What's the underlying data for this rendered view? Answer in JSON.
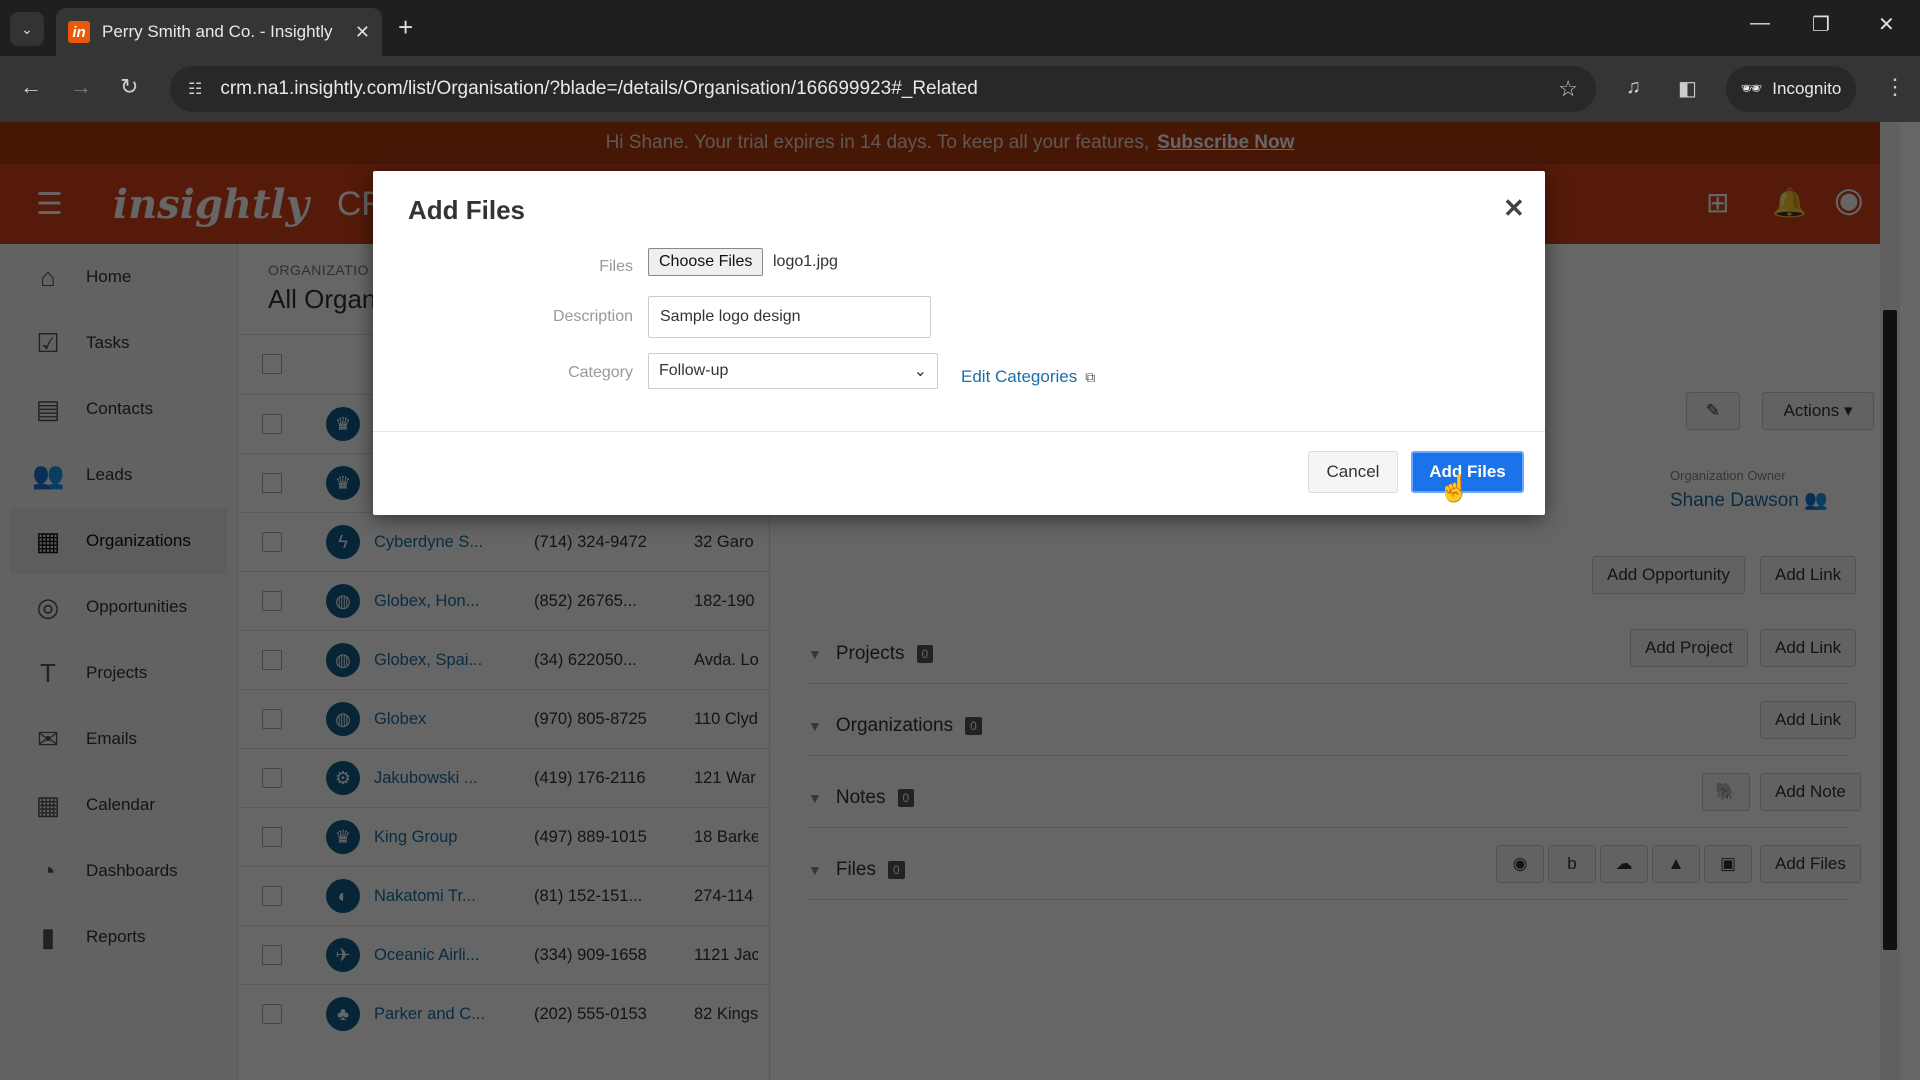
{
  "browser": {
    "tab_title": "Perry Smith and Co. - Insightly",
    "tab_favicon": "in",
    "url": "crm.na1.insightly.com/list/Organisation/?blade=/details/Organisation/166699923#_Related",
    "incognito_label": "Incognito"
  },
  "banner": {
    "text": "Hi Shane. Your trial expires in 14 days. To keep all your features,",
    "link": "Subscribe Now"
  },
  "appbar": {
    "logo": "insightly",
    "product": "CRM"
  },
  "sidebar": {
    "items": [
      {
        "label": "Home",
        "icon": "home-icon"
      },
      {
        "label": "Tasks",
        "icon": "tasks-icon"
      },
      {
        "label": "Contacts",
        "icon": "contacts-icon"
      },
      {
        "label": "Leads",
        "icon": "leads-icon"
      },
      {
        "label": "Organizations",
        "icon": "organizations-icon",
        "active": true
      },
      {
        "label": "Opportunities",
        "icon": "opportunities-icon"
      },
      {
        "label": "Projects",
        "icon": "projects-icon"
      },
      {
        "label": "Emails",
        "icon": "emails-icon"
      },
      {
        "label": "Calendar",
        "icon": "calendar-icon"
      },
      {
        "label": "Dashboards",
        "icon": "dashboards-icon"
      },
      {
        "label": "Reports",
        "icon": "reports-icon"
      }
    ]
  },
  "list": {
    "section_label": "ORGANIZATIO",
    "title": "All Organ",
    "rows": [
      {
        "name": "",
        "phone": "",
        "address": ""
      },
      {
        "name": "",
        "phone": "",
        "address": ""
      },
      {
        "name": "Cyberdyne S...",
        "phone": "(714) 324-9472",
        "address": "32 Garo"
      },
      {
        "name": "Globex, Hon...",
        "phone": "(852) 26765...",
        "address": "182-190"
      },
      {
        "name": "Globex, Spai...",
        "phone": "(34) 622050...",
        "address": "Avda. Lo"
      },
      {
        "name": "Globex",
        "phone": "(970) 805-8725",
        "address": "110 Clyd"
      },
      {
        "name": "Jakubowski ...",
        "phone": "(419) 176-2116",
        "address": "121 War"
      },
      {
        "name": "King Group",
        "phone": "(497) 889-1015",
        "address": "18 Barke"
      },
      {
        "name": "Nakatomi Tr...",
        "phone": "(81) 152-151...",
        "address": "274-114"
      },
      {
        "name": "Oceanic Airli...",
        "phone": "(334) 909-1658",
        "address": "1121 Jac"
      },
      {
        "name": "Parker and C...",
        "phone": "(202) 555-0153",
        "address": "82 Kings"
      }
    ]
  },
  "detail": {
    "actions_label": "Actions",
    "owner_label": "Organization Owner",
    "owner_name": "Shane Dawson",
    "sections": [
      {
        "title": "Projects",
        "count": "0",
        "buttons": [
          "Add Project",
          "Add Link"
        ]
      },
      {
        "title": "Organizations",
        "count": "0",
        "buttons": [
          "Add Link"
        ]
      },
      {
        "title": "Notes",
        "count": "0",
        "buttons": [
          "Add Note"
        ]
      },
      {
        "title": "Files",
        "count": "0",
        "buttons": [
          "Add Files"
        ]
      }
    ],
    "opportunity_buttons": [
      "Add Opportunity",
      "Add Link"
    ]
  },
  "modal": {
    "title": "Add Files",
    "files_label": "Files",
    "choose_files_label": "Choose Files",
    "file_name": "logo1.jpg",
    "description_label": "Description",
    "description_value": "Sample logo design",
    "category_label": "Category",
    "category_value": "Follow-up",
    "edit_categories_label": "Edit Categories",
    "cancel_label": "Cancel",
    "submit_label": "Add Files"
  }
}
